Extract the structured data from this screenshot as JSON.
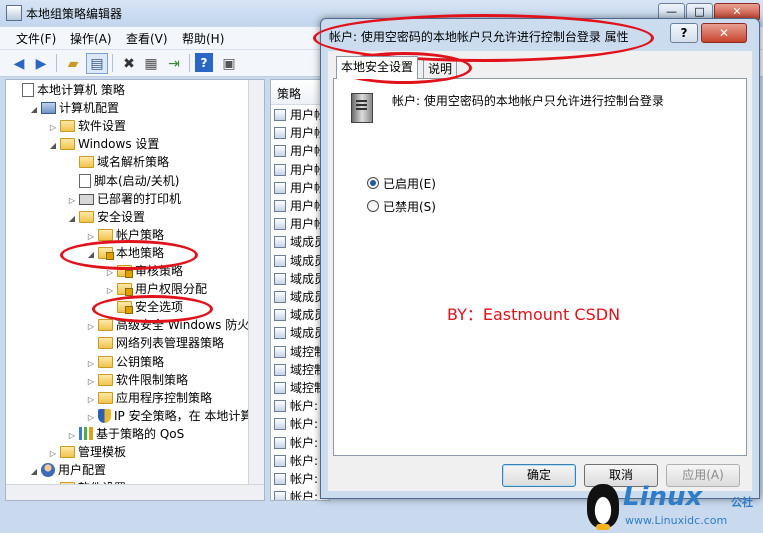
{
  "main": {
    "title": "本地组策略编辑器",
    "menu": [
      "文件(F)",
      "操作(A)",
      "查看(V)",
      "帮助(H)"
    ],
    "window_controls": [
      "—",
      "□",
      "✕"
    ]
  },
  "tree": {
    "items": [
      {
        "label": "本地计算机 策略",
        "level": 0,
        "icon": "doc-icon",
        "arrow": ""
      },
      {
        "label": "计算机配置",
        "level": 1,
        "icon": "computer-icon",
        "arrow": "◢"
      },
      {
        "label": "软件设置",
        "level": 2,
        "icon": "folder-icon",
        "arrow": "▷"
      },
      {
        "label": "Windows 设置",
        "level": 2,
        "icon": "folder-icon",
        "arrow": "◢"
      },
      {
        "label": "域名解析策略",
        "level": 3,
        "icon": "folder-icon",
        "arrow": ""
      },
      {
        "label": "脚本(启动/关机)",
        "level": 3,
        "icon": "doc-icon",
        "arrow": ""
      },
      {
        "label": "已部署的打印机",
        "level": 3,
        "icon": "printer-icon",
        "arrow": "▷"
      },
      {
        "label": "安全设置",
        "level": 3,
        "icon": "folder-icon",
        "arrow": "◢"
      },
      {
        "label": "帐户策略",
        "level": 4,
        "icon": "folder-icon",
        "arrow": "▷"
      },
      {
        "label": "本地策略",
        "level": 4,
        "icon": "folder-lock-icon",
        "arrow": "◢"
      },
      {
        "label": "审核策略",
        "level": 5,
        "icon": "folder-lock-icon",
        "arrow": "▷"
      },
      {
        "label": "用户权限分配",
        "level": 5,
        "icon": "folder-lock-icon",
        "arrow": "▷"
      },
      {
        "label": "安全选项",
        "level": 5,
        "icon": "folder-lock-icon",
        "arrow": ""
      },
      {
        "label": "高级安全 Windows 防火墙",
        "level": 4,
        "icon": "folder-icon",
        "arrow": "▷"
      },
      {
        "label": "网络列表管理器策略",
        "level": 4,
        "icon": "folder-icon",
        "arrow": ""
      },
      {
        "label": "公钥策略",
        "level": 4,
        "icon": "folder-icon",
        "arrow": "▷"
      },
      {
        "label": "软件限制策略",
        "level": 4,
        "icon": "folder-icon",
        "arrow": "▷"
      },
      {
        "label": "应用程序控制策略",
        "level": 4,
        "icon": "folder-icon",
        "arrow": "▷"
      },
      {
        "label": "IP 安全策略，在 本地计算",
        "level": 4,
        "icon": "shield-icon",
        "arrow": "▷"
      },
      {
        "label": "基于策略的 QoS",
        "level": 3,
        "icon": "bars-icon",
        "arrow": "▷"
      },
      {
        "label": "管理模板",
        "level": 2,
        "icon": "folder-icon",
        "arrow": "▷"
      },
      {
        "label": "用户配置",
        "level": 1,
        "icon": "user-icon",
        "arrow": "◢"
      },
      {
        "label": "软件设置",
        "level": 2,
        "icon": "folder-icon",
        "arrow": "▷"
      }
    ]
  },
  "list": {
    "header": "策略",
    "rows": [
      "用户帐",
      "用户帐",
      "用户帐",
      "用户帐",
      "用户帐",
      "用户帐",
      "用户帐",
      "域成员",
      "域成员",
      "域成员",
      "域成员",
      "域成员",
      "域成员",
      "域控制",
      "域控制",
      "域控制",
      "帐户:",
      "帐户:",
      "帐户:",
      "帐户:",
      "帐户:",
      "帐户:"
    ]
  },
  "dialog": {
    "title": "帐户: 使用空密码的本地帐户只允许进行控制台登录 属性",
    "help": "?",
    "close": "✕",
    "tabs": [
      "本地安全设置",
      "说明"
    ],
    "policy_name": "帐户: 使用空密码的本地帐户只允许进行控制台登录",
    "options": [
      {
        "label": "已启用(E)",
        "checked": true
      },
      {
        "label": "已禁用(S)",
        "checked": false
      }
    ],
    "annotation": "BY：Eastmount CSDN",
    "buttons": {
      "ok": "确定",
      "cancel": "取消",
      "apply": "应用(A)"
    }
  },
  "watermark": {
    "brand": "Linux",
    "suffix": "公社",
    "url": "www.Linuxidc.com"
  },
  "colors": {
    "annotation_red": "#e0121b",
    "brand_blue": "#2f7cc9"
  }
}
